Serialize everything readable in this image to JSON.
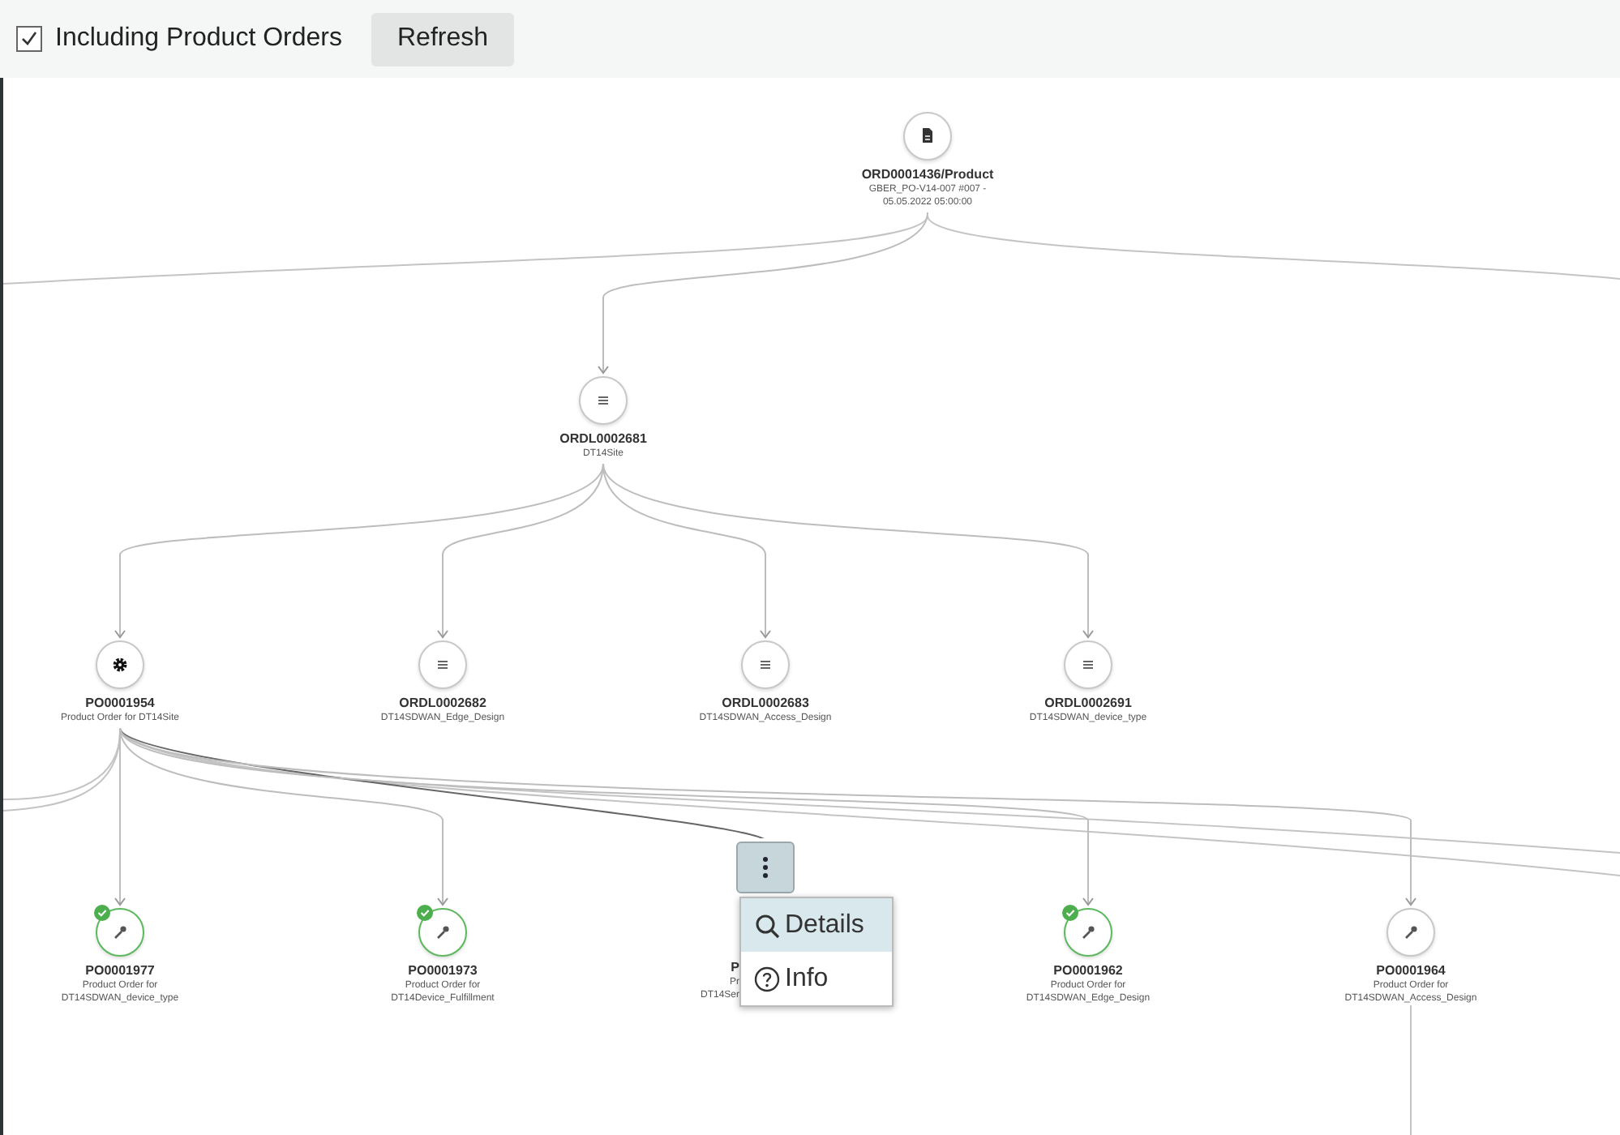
{
  "toolbar": {
    "checkbox": {
      "label": "Including Product Orders",
      "checked": true
    },
    "refresh_button": "Refresh"
  },
  "tree": {
    "kind": "doc",
    "done": false,
    "title": "ORD0001436/Product",
    "lines": [
      "GBER_PO-V14-007 #007 -",
      "05.05.2022 05:00:00"
    ],
    "children": [
      {
        "kind": "list",
        "done": false,
        "title": "ORDL0002681",
        "lines": [
          "DT14Site"
        ],
        "children": [
          {
            "kind": "gear",
            "done": false,
            "title": "PO0001954",
            "lines": [
              "Product Order for DT14Site"
            ],
            "children": [
              {
                "kind": "wrench",
                "done": true,
                "title": "PO0001977",
                "lines": [
                  "Product Order for",
                  "DT14SDWAN_device_type"
                ]
              },
              {
                "kind": "wrench",
                "done": true,
                "title": "PO0001973",
                "lines": [
                  "Product Order for",
                  "DT14Device_Fulfillment"
                ]
              },
              {
                "kind": "covered",
                "title": "P",
                "lines": [
                  "Pr",
                  "DT14Ser"
                ]
              },
              {
                "kind": "wrench",
                "done": true,
                "title": "PO0001962",
                "lines": [
                  "Product Order for",
                  "DT14SDWAN_Edge_Design"
                ]
              },
              {
                "kind": "wrench",
                "done": false,
                "title": "PO0001964",
                "lines": [
                  "Product Order for",
                  "DT14SDWAN_Access_Design"
                ]
              }
            ]
          },
          {
            "kind": "list",
            "done": false,
            "title": "ORDL0002682",
            "lines": [
              "DT14SDWAN_Edge_Design"
            ]
          },
          {
            "kind": "list",
            "done": false,
            "title": "ORDL0002683",
            "lines": [
              "DT14SDWAN_Access_Design"
            ]
          },
          {
            "kind": "list",
            "done": false,
            "title": "ORDL0002691",
            "lines": [
              "DT14SDWAN_device_type"
            ]
          }
        ]
      }
    ]
  },
  "context_menu": {
    "items": [
      {
        "label": "Details",
        "selected": true
      },
      {
        "label": "Info",
        "selected": false
      }
    ]
  }
}
